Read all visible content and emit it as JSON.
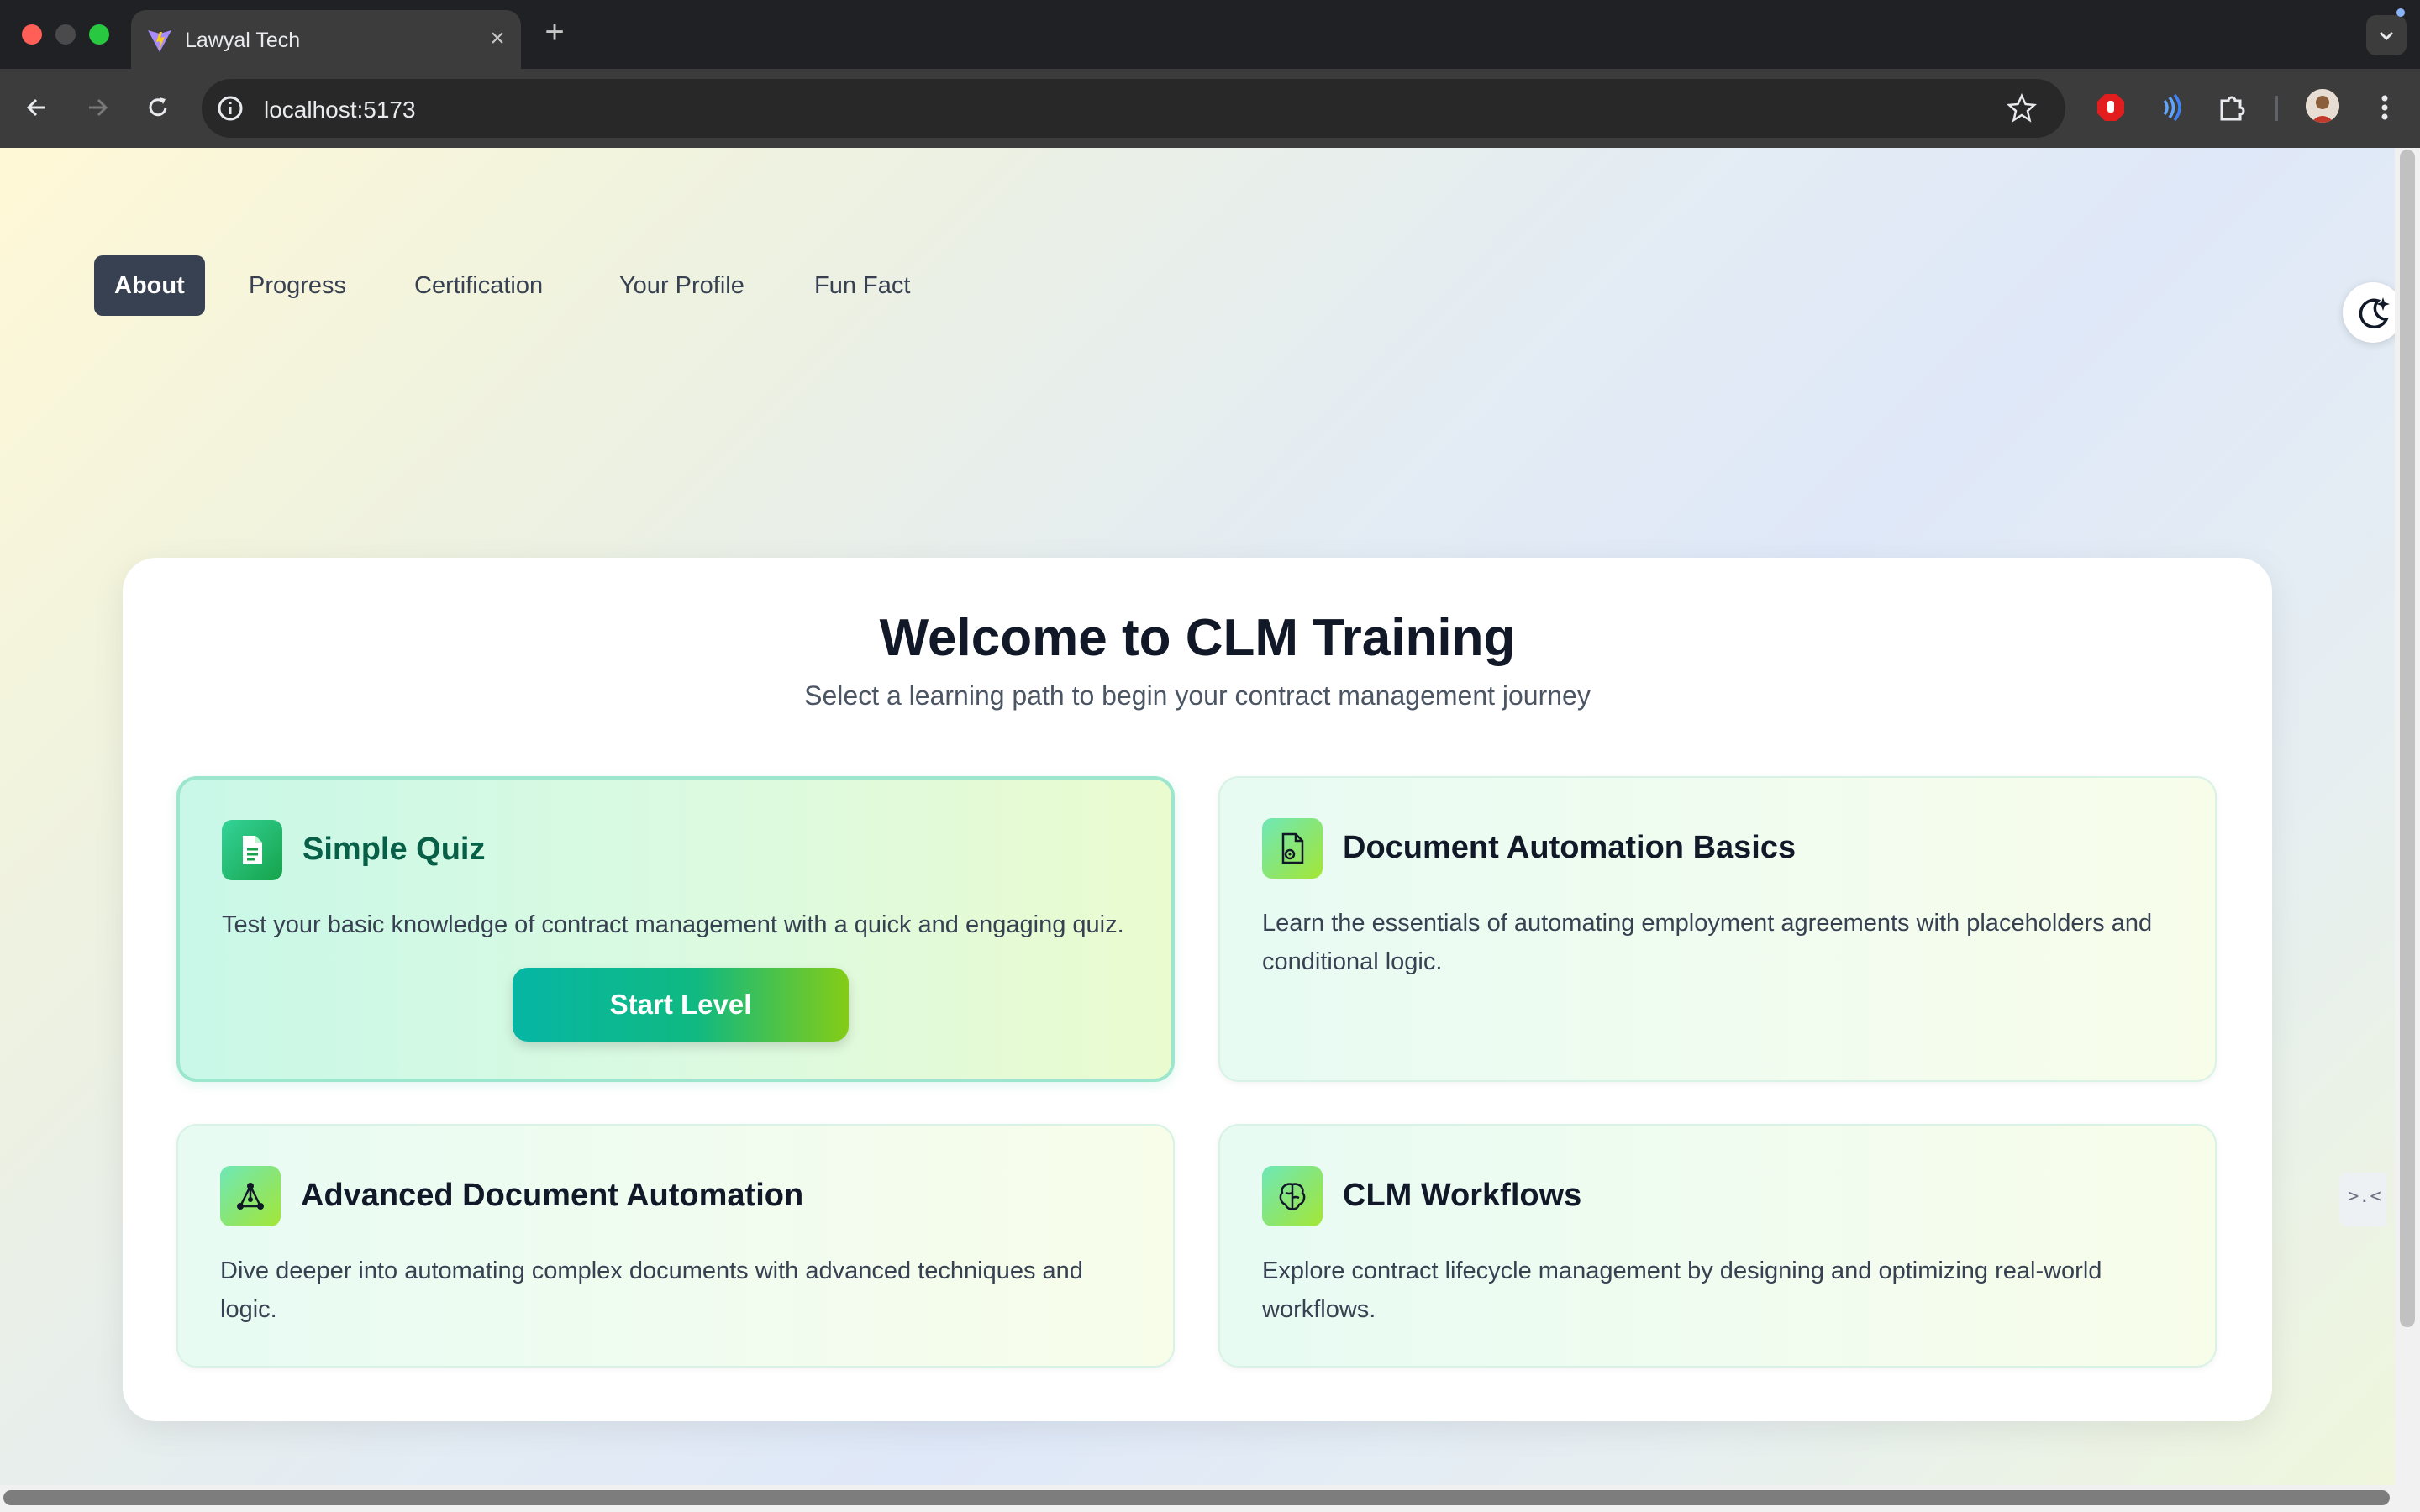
{
  "browser": {
    "tab_title": "Lawyal Tech",
    "url": "localhost:5173"
  },
  "nav": {
    "items": [
      {
        "label": "About",
        "active": true
      },
      {
        "label": "Progress",
        "active": false
      },
      {
        "label": "Certification",
        "active": false
      },
      {
        "label": "Your Profile",
        "active": false
      },
      {
        "label": "Fun Fact",
        "active": false
      }
    ]
  },
  "main": {
    "title": "Welcome to CLM Training",
    "subtitle": "Select a learning path to begin your contract management journey",
    "cards": [
      {
        "title": "Simple Quiz",
        "description": "Test your basic knowledge of contract management with a quick and engaging quiz.",
        "icon": "document-icon",
        "selected": true,
        "button": "Start Level"
      },
      {
        "title": "Document Automation Basics",
        "description": "Learn the essentials of automating employment agreements with placeholders and conditional logic.",
        "icon": "file-gear-icon",
        "selected": false
      },
      {
        "title": "Advanced Document Automation",
        "description": "Dive deeper into automating complex documents with advanced techniques and logic.",
        "icon": "network-icon",
        "selected": false
      },
      {
        "title": "CLM Workflows",
        "description": "Explore contract lifecycle management by designing and optimizing real-world workflows.",
        "icon": "brain-icon",
        "selected": false
      }
    ]
  },
  "colors": {
    "nav_active_bg": "#374151",
    "accent_start": "#06b6a4",
    "accent_end": "#84cc16",
    "title_text": "#111827"
  }
}
